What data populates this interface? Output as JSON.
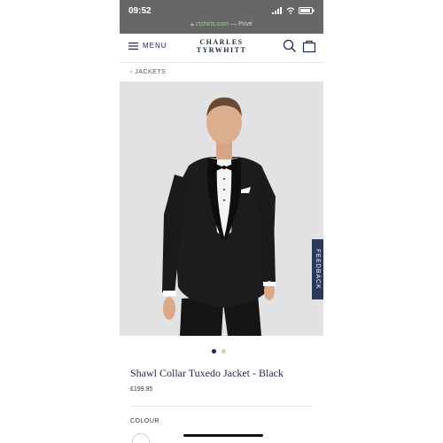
{
  "status": {
    "time": "09:52",
    "url_host": "ctshirts.com",
    "url_suffix": " — Privé"
  },
  "header": {
    "menu_label": "MENU",
    "logo_line1": "CHARLES",
    "logo_line2": "TYRWHITT"
  },
  "breadcrumb": {
    "label": "JACKETS"
  },
  "feedback": {
    "label": "FEEDBACK"
  },
  "product": {
    "title": "Shawl Collar Tuxedo Jacket - Black",
    "price": "£199.95",
    "colour_label": "COLOUR",
    "image_count": 2,
    "active_image": 1
  },
  "colors": {
    "navy": "#1e2a45",
    "status_bar": "#676767",
    "image_bg": "#e2e2e4"
  }
}
